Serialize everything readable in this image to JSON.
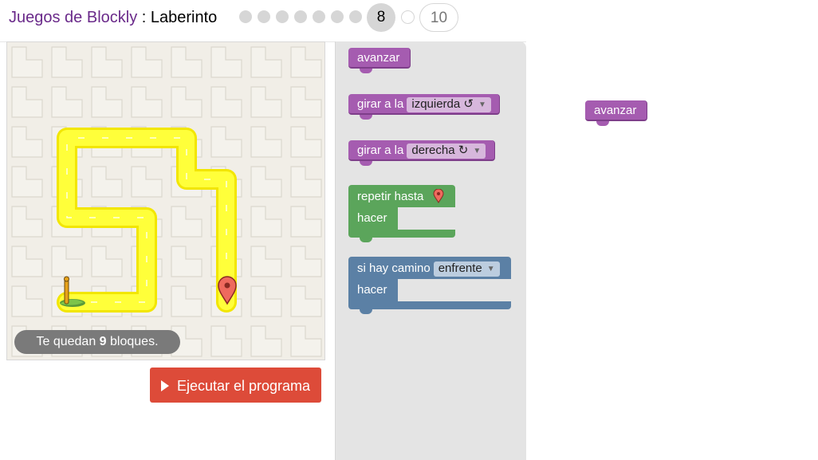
{
  "header": {
    "app_title": "Juegos de Blockly",
    "separator": " : ",
    "game_title": "Laberinto",
    "current_level": "8",
    "last_level": "10"
  },
  "maze": {
    "capacity_prefix": "Te quedan ",
    "capacity_count": "9",
    "capacity_suffix": " bloques."
  },
  "run_button": {
    "label": "Ejecutar el programa"
  },
  "toolbox": {
    "move_forward": "avanzar",
    "turn_left_label": "girar a la",
    "turn_left_option": "izquierda ↺",
    "turn_right_label": "girar a la",
    "turn_right_option": "derecha ↻",
    "repeat_label": "repetir hasta",
    "repeat_do": "hacer",
    "if_label": "si hay camino",
    "if_option": "enfrente",
    "if_do": "hacer"
  },
  "workspace": {
    "block_label": "avanzar"
  },
  "colors": {
    "motion": "#a55cb0",
    "loop": "#5ba55b",
    "logic": "#5b80a5",
    "path": "#ffff00",
    "run": "#dd4b39"
  }
}
